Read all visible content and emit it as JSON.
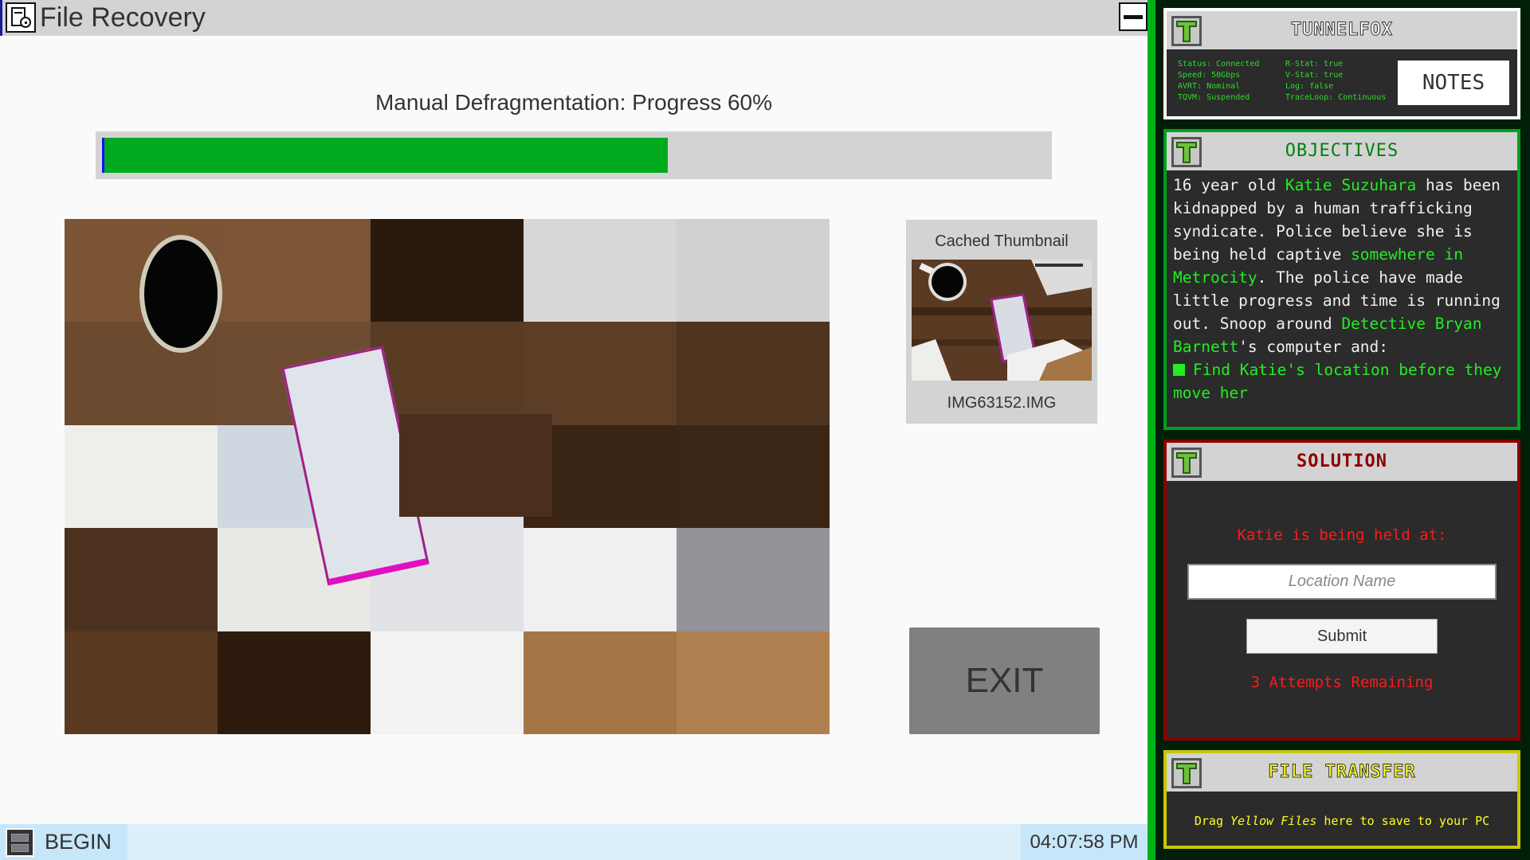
{
  "window": {
    "title": "File Recovery",
    "icon": "file-recovery-icon",
    "minimize_icon": "minimize-icon"
  },
  "progress": {
    "label": "Manual Defragmentation: Progress 60%",
    "percent": 60,
    "fill_color": "#00aa1e"
  },
  "puzzle": {
    "grid": "5x5",
    "empty_slots": 2
  },
  "thumbnail": {
    "title": "Cached Thumbnail",
    "filename": "IMG63152.IMG"
  },
  "exit_label": "EXIT",
  "taskbar": {
    "begin_label": "BEGIN",
    "clock": "04:07:58 PM"
  },
  "tunnelfox": {
    "title": "TUNNELFOX",
    "stats_left": [
      "Status: Connected",
      "Speed: 50Gbps",
      "AVRT: Nominal",
      "TQVM: Suspended"
    ],
    "stats_right": [
      "R-Stat: true",
      "V-Stat: true",
      "Log: false",
      "TraceLoop: Continuous"
    ],
    "notes_label": "NOTES"
  },
  "objectives": {
    "title": "OBJECTIVES",
    "p1": "16 year old ",
    "name": "Katie Suzuhara",
    "p2": " has been kidnapped by a human trafficking syndicate. Police believe she is being held captive ",
    "place": "somewhere in Metrocity",
    "p3": ". The police have made little progress and time is running out. Snoop around ",
    "detective": "Detective Bryan Barnett",
    "p4": "'s computer and:",
    "goal": "Find Katie's location before they move her"
  },
  "solution": {
    "title": "SOLUTION",
    "label": "Katie is being held at:",
    "input_value": "",
    "input_placeholder": "Location Name",
    "submit_label": "Submit",
    "attempts": "3 Attempts Remaining"
  },
  "file_transfer": {
    "title": "FILE TRANSFER",
    "text_pre": "Drag ",
    "text_em": "Yellow Files",
    "text_post": " here to save to your PC"
  },
  "colors": {
    "objectives_border": "#00a01a",
    "solution_border": "#8b0000",
    "transfer_border": "#c8c800",
    "highlight_green": "#22ee22",
    "alert_red": "#ff1a1a",
    "transfer_yellow": "#ffff20"
  }
}
